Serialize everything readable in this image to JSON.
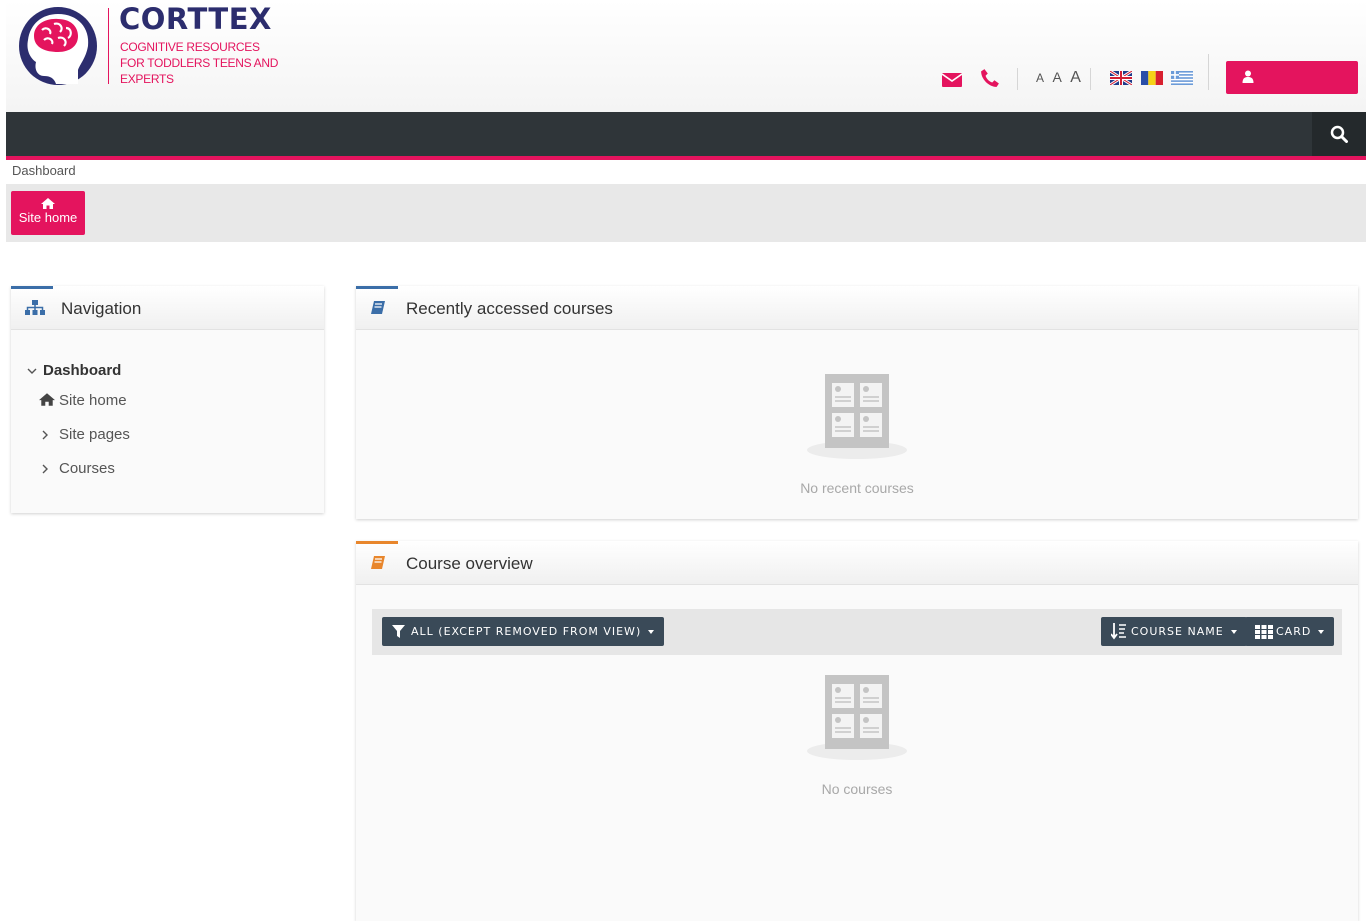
{
  "header": {
    "brand_title": "CORTTEX",
    "brand_subtitle": "COGNITIVE RESOURCES FOR TODDLERS TEENS AND EXPERTS",
    "font_size_letters": [
      "A",
      "A",
      "A"
    ],
    "icons": [
      "envelope-icon",
      "phone-icon",
      "search-icon",
      "user-icon"
    ],
    "flags": [
      "flag-uk",
      "flag-romania",
      "flag-greece"
    ],
    "accent_color": "#e4145e",
    "brand_color": "#2c2d6e"
  },
  "breadcrumb": {
    "current": "Dashboard"
  },
  "subbar": {
    "site_home_label": "Site home"
  },
  "navigation_block": {
    "title": "Navigation",
    "items": [
      {
        "label": "Dashboard",
        "icon": "chevron-down-icon"
      },
      {
        "label": "Site home",
        "icon": "home-icon"
      },
      {
        "label": "Site pages",
        "icon": "chevron-right-icon"
      },
      {
        "label": "Courses",
        "icon": "chevron-right-icon"
      }
    ]
  },
  "recent_courses": {
    "title": "Recently accessed courses",
    "empty_text": "No recent courses"
  },
  "course_overview": {
    "title": "Course overview",
    "filter_label": "ALL (EXCEPT REMOVED FROM VIEW)",
    "sort_label": "COURSE NAME",
    "view_label": "CARD",
    "empty_text": "No courses"
  }
}
